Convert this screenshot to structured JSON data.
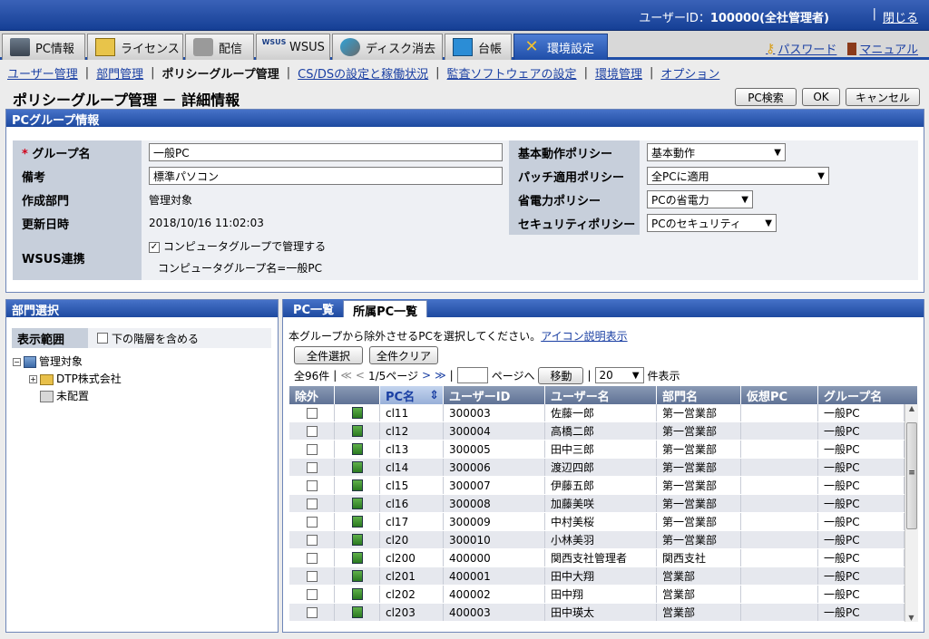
{
  "header": {
    "user_label": "ユーザーID：",
    "user_value": "100000(全社管理者)",
    "sep": "|",
    "logout": "閉じる"
  },
  "tabs": [
    {
      "label": "PC情報",
      "icon": "pc-icon"
    },
    {
      "label": "ライセンス",
      "icon": "license-icon"
    },
    {
      "label": "配信",
      "icon": "distribution-icon"
    },
    {
      "label": "WSUS",
      "icon": "wsus-icon"
    },
    {
      "label": "ディスク消去",
      "icon": "disk-erase-icon"
    },
    {
      "label": "台帳",
      "icon": "ledger-icon"
    },
    {
      "label": "環境設定",
      "icon": "tools-icon"
    }
  ],
  "wsus_icon_text": "WSUS",
  "links": {
    "password": "パスワード",
    "manual": "マニュアル"
  },
  "subnav": {
    "items": [
      "ユーザー管理",
      "部門管理",
      "ポリシーグループ管理",
      "CS/DSの設定と稼働状況",
      "監査ソフトウェアの設定",
      "環境管理",
      "オプション"
    ],
    "current": "ポリシーグループ管理"
  },
  "page_title": "ポリシーグループ管理 － 詳細情報",
  "buttons": {
    "pc_search": "PC検索",
    "ok": "OK",
    "cancel": "キャンセル"
  },
  "pcgroup": {
    "title": "PCグループ情報",
    "required_mark": "*",
    "group_name_label": "グループ名",
    "group_name_value": "一般PC",
    "remarks_label": "備考",
    "remarks_value": "標準パソコン",
    "created_dept_label": "作成部門",
    "created_dept_value": "管理対象",
    "updated_label": "更新日時",
    "updated_value": "2018/10/16 11:02:03",
    "wsus_label": "WSUS連携",
    "wsus_check": "✓",
    "wsus_check_label": "コンピュータグループで管理する",
    "wsus_group_text": "コンピュータグループ名=一般PC",
    "basic_policy_label": "基本動作ポリシー",
    "basic_policy_value": "基本動作",
    "patch_policy_label": "パッチ適用ポリシー",
    "patch_policy_value": "全PCに適用",
    "power_policy_label": "省電力ポリシー",
    "power_policy_value": "PCの省電力",
    "security_policy_label": "セキュリティポリシー",
    "security_policy_value": "PCのセキュリティ",
    "dropdown_arrow": "▼"
  },
  "dept": {
    "title": "部門選択",
    "range_label": "表示範囲",
    "include_sub": "下の階層を含める",
    "tree": [
      {
        "label": "管理対象",
        "toggle": "−"
      },
      {
        "label": "DTP株式会社",
        "toggle": "+"
      },
      {
        "label": "未配置"
      }
    ]
  },
  "pclist": {
    "tab_all": "PC一覧",
    "tab_belong": "所属PC一覧",
    "instruction": "本グループから除外させるPCを選択してください。",
    "icon_link": "アイコン説明表示",
    "select_all": "全件選択",
    "clear_all": "全件クリア",
    "total": "全96件",
    "sep": "|",
    "first": "≪",
    "prev": "<",
    "page_info": "1/5ページ",
    "next": ">",
    "last": "≫",
    "page_to": "ページへ",
    "move": "移動",
    "per_page": "20",
    "per_page_unit": "件表示",
    "sort_icon": "⇕",
    "columns": [
      "除外",
      "",
      "PC名",
      "ユーザーID",
      "ユーザー名",
      "部門名",
      "仮想PC",
      "グループ名"
    ],
    "rows": [
      {
        "pc": "cl11",
        "uid": "300003",
        "uname": "佐藤一郎",
        "dept": "第一営業部",
        "vpc": "",
        "group": "一般PC"
      },
      {
        "pc": "cl12",
        "uid": "300004",
        "uname": "高橋二郎",
        "dept": "第一営業部",
        "vpc": "",
        "group": "一般PC"
      },
      {
        "pc": "cl13",
        "uid": "300005",
        "uname": "田中三郎",
        "dept": "第一営業部",
        "vpc": "",
        "group": "一般PC"
      },
      {
        "pc": "cl14",
        "uid": "300006",
        "uname": "渡辺四郎",
        "dept": "第一営業部",
        "vpc": "",
        "group": "一般PC"
      },
      {
        "pc": "cl15",
        "uid": "300007",
        "uname": "伊藤五郎",
        "dept": "第一営業部",
        "vpc": "",
        "group": "一般PC"
      },
      {
        "pc": "cl16",
        "uid": "300008",
        "uname": "加藤美咲",
        "dept": "第一営業部",
        "vpc": "",
        "group": "一般PC"
      },
      {
        "pc": "cl17",
        "uid": "300009",
        "uname": "中村美桜",
        "dept": "第一営業部",
        "vpc": "",
        "group": "一般PC"
      },
      {
        "pc": "cl20",
        "uid": "300010",
        "uname": "小林美羽",
        "dept": "第一営業部",
        "vpc": "",
        "group": "一般PC"
      },
      {
        "pc": "cl200",
        "uid": "400000",
        "uname": "関西支社管理者",
        "dept": "関西支社",
        "vpc": "",
        "group": "一般PC"
      },
      {
        "pc": "cl201",
        "uid": "400001",
        "uname": "田中大翔",
        "dept": "営業部",
        "vpc": "",
        "group": "一般PC"
      },
      {
        "pc": "cl202",
        "uid": "400002",
        "uname": "田中翔",
        "dept": "営業部",
        "vpc": "",
        "group": "一般PC"
      },
      {
        "pc": "cl203",
        "uid": "400003",
        "uname": "田中瑛太",
        "dept": "営業部",
        "vpc": "",
        "group": "一般PC"
      }
    ]
  },
  "scroll_arrows": {
    "up": "▲",
    "down": "▼",
    "grip": "≡"
  }
}
